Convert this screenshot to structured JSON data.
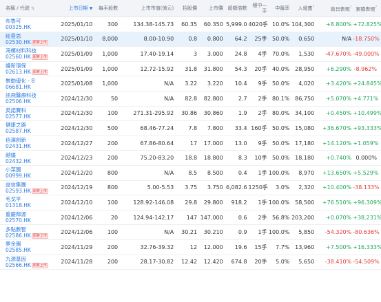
{
  "header": {
    "name": "名稱 / 代號",
    "listing_date": "上市日期",
    "lot_size": "每手股數",
    "ipo_price_range": "上市市值(億元)",
    "offer_price": "招股價",
    "listing_price": "上市價",
    "oversub": "超額倍數",
    "lots_per_win": "穩中一手",
    "win_rate": "中籤率",
    "entry_fee": "入場費",
    "first_day": "首日表現",
    "cumulative": "累積表現"
  },
  "badge_text": "即將上市",
  "rows": [
    {
      "name": "布魯可",
      "code": "00325.HK",
      "badge": false,
      "date": "2025/01/10",
      "lot": "300",
      "range": "134.38-145.73",
      "offer": "60.35",
      "listing": "60.350",
      "oversub": "5,999.0",
      "lots": "4020手",
      "rate": "10.0%",
      "fee": "104,300",
      "first": "+8.800%",
      "first_dir": "up",
      "cum": "+72.825%",
      "cum_dir": "up",
      "hl": false
    },
    {
      "name": "紐曼思",
      "code": "02530.HK",
      "badge": true,
      "date": "2025/01/10",
      "lot": "8,000",
      "range": "8.00-10.90",
      "offer": "0.8",
      "listing": "0.800",
      "oversub": "64.2",
      "lots": "25手",
      "rate": "50.0%",
      "fee": "0.650",
      "first": "N/A",
      "first_dir": "neutral",
      "cum": "-18.750%",
      "cum_dir": "down",
      "hl": true
    },
    {
      "name": "海螺材料科技",
      "code": "02560.HK",
      "badge": true,
      "date": "2025/01/09",
      "lot": "1,000",
      "range": "17.40-19.14",
      "offer": "3",
      "listing": "3.000",
      "oversub": "24.8",
      "lots": "4手",
      "rate": "70.0%",
      "fee": "1,530",
      "first": "-47.670%",
      "first_dir": "down",
      "cum": "-49.000%",
      "cum_dir": "down",
      "hl": false
    },
    {
      "name": "護新環保",
      "code": "02613.HK",
      "badge": true,
      "date": "2025/01/09",
      "lot": "1,000",
      "range": "12.72-15.92",
      "offer": "31.8",
      "listing": "31.800",
      "oversub": "54.3",
      "lots": "20手",
      "rate": "40.0%",
      "fee": "28,950",
      "first": "+6.290%",
      "first_dir": "up",
      "cum": "-8.962%",
      "cum_dir": "down",
      "hl": false
    },
    {
      "name": "聚動優化 - B",
      "code": "06681.HK",
      "badge": false,
      "date": "2025/01/08",
      "lot": "1,000",
      "range": "N/A",
      "offer": "3.22",
      "listing": "3.220",
      "oversub": "10.4",
      "lots": "9手",
      "rate": "50.0%",
      "fee": "4,020",
      "first": "+3.420%",
      "first_dir": "up",
      "cum": "+24.845%",
      "cum_dir": "up",
      "hl": false
    },
    {
      "name": "訊飛醫療科技",
      "code": "02506.HK",
      "badge": false,
      "date": "2024/12/30",
      "lot": "50",
      "range": "N/A",
      "offer": "82.8",
      "listing": "82.800",
      "oversub": "2.7",
      "lots": "2手",
      "rate": "80.1%",
      "fee": "86,750",
      "first": "+5.070%",
      "first_dir": "up",
      "cum": "+4.771%",
      "cum_dir": "up",
      "hl": false
    },
    {
      "name": "英諾賽科",
      "code": "02577.HK",
      "badge": false,
      "date": "2024/12/30",
      "lot": "100",
      "range": "271.31-295.92",
      "offer": "30.86",
      "listing": "30.860",
      "oversub": "1.9",
      "lots": "2手",
      "rate": "80.0%",
      "fee": "34,100",
      "first": "+0.450%",
      "first_dir": "up",
      "cum": "+10.499%",
      "cum_dir": "up",
      "hl": false
    },
    {
      "name": "健康之路",
      "code": "02587.HK",
      "badge": false,
      "date": "2024/12/30",
      "lot": "500",
      "range": "68.46-77.24",
      "offer": "7.8",
      "listing": "7.800",
      "oversub": "33.4",
      "lots": "160手",
      "rate": "50.0%",
      "fee": "15,080",
      "first": "+36.670%",
      "first_dir": "up",
      "cum": "+93.333%",
      "cum_dir": "up",
      "hl": false
    },
    {
      "name": "佰澤創新",
      "code": "02431.HK",
      "badge": false,
      "date": "2024/12/27",
      "lot": "200",
      "range": "67.86-80.64",
      "offer": "17",
      "listing": "17.000",
      "oversub": "13.0",
      "lots": "9手",
      "rate": "50.0%",
      "fee": "17,180",
      "first": "+14.120%",
      "first_dir": "up",
      "cum": "+1.059%",
      "cum_dir": "up",
      "hl": false
    },
    {
      "name": "越疆",
      "code": "02432.HK",
      "badge": false,
      "date": "2024/12/23",
      "lot": "200",
      "range": "75.20-83.20",
      "offer": "18.8",
      "listing": "18.800",
      "oversub": "8.3",
      "lots": "10手",
      "rate": "50.0%",
      "fee": "18,180",
      "first": "+0.740%",
      "first_dir": "up",
      "cum": "0.000%",
      "cum_dir": "neutral",
      "hl": false
    },
    {
      "name": "小菜園",
      "code": "00999.HK",
      "badge": false,
      "date": "2024/12/20",
      "lot": "800",
      "range": "N/A",
      "offer": "8.5",
      "listing": "8.500",
      "oversub": "0.4",
      "lots": "1手",
      "rate": "100.0%",
      "fee": "8,970",
      "first": "+13.650%",
      "first_dir": "up",
      "cum": "+5.529%",
      "cum_dir": "up",
      "hl": false
    },
    {
      "name": "益信集團",
      "code": "02593.HK",
      "badge": true,
      "date": "2024/12/19",
      "lot": "800",
      "range": "5.00-5.53",
      "offer": "3.75",
      "listing": "3.750",
      "oversub": "6,082.6",
      "lots": "1250手",
      "rate": "3.0%",
      "fee": "2,320",
      "first": "+10.400%",
      "first_dir": "up",
      "cum": "-38.133%",
      "cum_dir": "down",
      "hl": false
    },
    {
      "name": "毛戈平",
      "code": "01318.HK",
      "badge": false,
      "date": "2024/12/10",
      "lot": "100",
      "range": "128.92-146.08",
      "offer": "29.8",
      "listing": "29.800",
      "oversub": "918.2",
      "lots": "1手",
      "rate": "100.0%",
      "fee": "58,500",
      "first": "+76.510%",
      "first_dir": "up",
      "cum": "+96.309%",
      "cum_dir": "up",
      "hl": false
    },
    {
      "name": "重慶鄰源",
      "code": "02570.HK",
      "badge": false,
      "date": "2024/12/06",
      "lot": "20",
      "range": "124.94-142.17",
      "offer": "147",
      "listing": "147.000",
      "oversub": "0.6",
      "lots": "2手",
      "rate": "56.8%",
      "fee": "203,200",
      "first": "+0.070%",
      "first_dir": "up",
      "cum": "+38.231%",
      "cum_dir": "up",
      "hl": false
    },
    {
      "name": "多點數智",
      "code": "02586.HK",
      "badge": true,
      "date": "2024/12/06",
      "lot": "100",
      "range": "N/A",
      "offer": "30.21",
      "listing": "30.210",
      "oversub": "0.9",
      "lots": "1手",
      "rate": "100.0%",
      "fee": "5,850",
      "first": "-54.320%",
      "first_dir": "down",
      "cum": "-80.636%",
      "cum_dir": "down",
      "hl": false
    },
    {
      "name": "夢金園",
      "code": "02585.HK",
      "badge": false,
      "date": "2024/11/29",
      "lot": "200",
      "range": "32.76-39.32",
      "offer": "12",
      "listing": "12.000",
      "oversub": "19.6",
      "lots": "15手",
      "rate": "7.7%",
      "fee": "13,960",
      "first": "+7.500%",
      "first_dir": "up",
      "cum": "+16.333%",
      "cum_dir": "up",
      "hl": false
    },
    {
      "name": "九源基因",
      "code": "02566.HK",
      "badge": true,
      "date": "2024/11/28",
      "lot": "200",
      "range": "28.17-30.82",
      "offer": "12.42",
      "listing": "12.420",
      "oversub": "674.8",
      "lots": "20手",
      "rate": "5.0%",
      "fee": "5,650",
      "first": "-38.410%",
      "first_dir": "down",
      "cum": "-54.509%",
      "cum_dir": "down",
      "hl": false
    }
  ],
  "colors": {
    "up": "#22a65a",
    "down": "#e23d3d",
    "link": "#2f7de1",
    "highlight": "#e8f2fd"
  }
}
